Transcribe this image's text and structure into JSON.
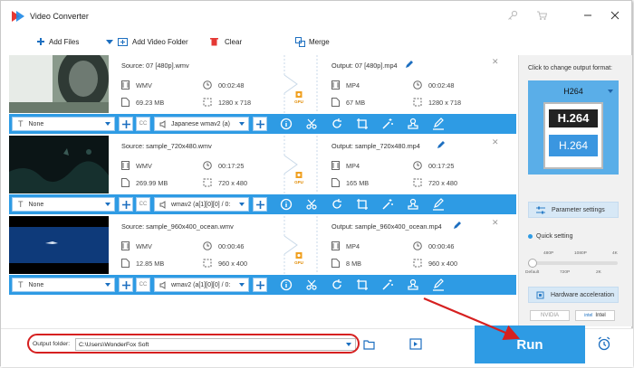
{
  "app": {
    "title": "Video Converter"
  },
  "toolbar": {
    "add_files": "Add Files",
    "add_video_folder": "Add Video Folder",
    "clear": "Clear",
    "merge": "Merge"
  },
  "items": [
    {
      "source": "Source: 07 [480p].wmv",
      "output": "Output: 07 [480p].mp4",
      "src_format": "WMV",
      "src_duration": "00:02:48",
      "src_size": "69.23 MB",
      "src_resolution": "1280 x 718",
      "out_format": "MP4",
      "out_duration": "00:02:48",
      "out_size": "67 MB",
      "out_resolution": "1280 x 718",
      "subtitle": "None",
      "audio": "Japanese wmav2 (a)"
    },
    {
      "source": "Source: sample_720x480.wmv",
      "output": "Output: sample_720x480.mp4",
      "src_format": "WMV",
      "src_duration": "00:17:25",
      "src_size": "269.99 MB",
      "src_resolution": "720 x 480",
      "out_format": "MP4",
      "out_duration": "00:17:25",
      "out_size": "165 MB",
      "out_resolution": "720 x 480",
      "subtitle": "None",
      "audio": "wmav2 (a[1][0][0] / 0:"
    },
    {
      "source": "Source: sample_960x400_ocean.wmv",
      "output": "Output: sample_960x400_ocean.mp4",
      "src_format": "WMV",
      "src_duration": "00:00:46",
      "src_size": "12.85 MB",
      "src_resolution": "960 x 400",
      "out_format": "MP4",
      "out_duration": "00:00:46",
      "out_size": "8 MB",
      "out_resolution": "960 x 400",
      "subtitle": "None",
      "audio": "wmav2 (a[1][0][0] / 0:"
    }
  ],
  "gpu_badge": "GPU",
  "side": {
    "hint": "Click to change output format:",
    "format_name": "H264",
    "format_icon_top": "H.264",
    "format_icon_bottom": "H.264",
    "parameter_settings": "Parameter settings",
    "quick_setting": "Quick setting",
    "ticks_top": [
      "480P",
      "1080P",
      "4K"
    ],
    "ticks_bottom": [
      "Default",
      "720P",
      "2K"
    ],
    "hardware_acceleration": "Hardware acceleration",
    "nvidia": "NVIDIA",
    "intel": "Intel"
  },
  "bottom": {
    "output_folder_label": "Output folder:",
    "output_folder_value": "C:\\Users\\WonderFox Soft",
    "run": "Run"
  },
  "colors": {
    "accent": "#2e9be4",
    "annotation": "#d62020"
  }
}
